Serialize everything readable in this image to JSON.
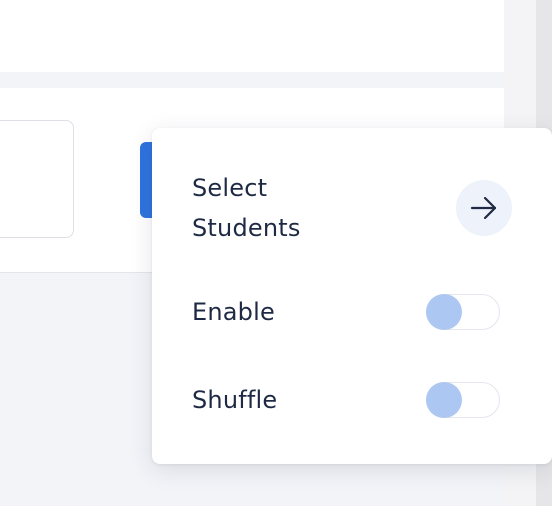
{
  "popover": {
    "select_students": {
      "label_line1": "Select",
      "label_line2": "Students",
      "icon": "arrow-right-icon"
    },
    "enable": {
      "label": "Enable",
      "on": false
    },
    "shuffle": {
      "label": "Shuffle",
      "on": false
    }
  },
  "colors": {
    "accent": "#2f73df",
    "text": "#1e2a44",
    "knob": "#adc7f3",
    "icon_bg": "#eef2fb"
  }
}
